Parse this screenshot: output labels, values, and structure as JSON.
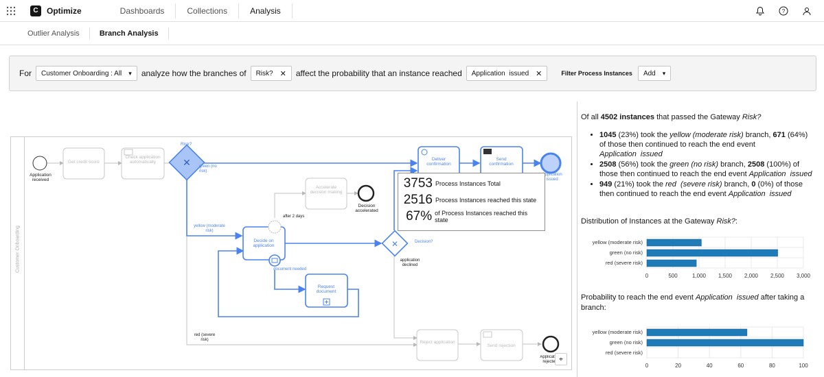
{
  "header": {
    "brand": "Optimize",
    "logo_letter": "C",
    "nav": [
      "Dashboards",
      "Collections",
      "Analysis"
    ]
  },
  "subnav": {
    "tabs": [
      "Outlier Analysis",
      "Branch Analysis"
    ]
  },
  "control": {
    "for_text": "For",
    "process_select": "Customer Onboarding : All",
    "analyze_text": "analyze how the branches of",
    "gateway_chip": "Risk?",
    "affect_text": "affect the probability that an instance reached",
    "end_event_chip": "Application  issued",
    "filter_label": "Filter Process Instances",
    "add_label": "Add"
  },
  "diagram": {
    "lane_name": "Customer Onboarding",
    "nodes": {
      "start": "Application received",
      "get_credit": "Get credit score",
      "check_app": "Check application automatically",
      "gateway_risk": "Risk?",
      "deliver": "Deliver confirmation",
      "send_conf": "Send confirmation",
      "end_issued": "Application issued",
      "accelerate": "Accelerate decision making",
      "decision_accel": "Decision accelerated",
      "after_days": "after 2 days",
      "decide": "Decide on application",
      "doc_needed": "document needed",
      "request_doc": "Request document",
      "decision_gw": "Decision?",
      "app_declined": "application declined",
      "reject": "Reject application",
      "send_rejection": "Send rejection",
      "end_rejected": "Application rejected"
    },
    "flows": {
      "green": "green (no risk)",
      "yellow": "yellow (moderate risk)",
      "red": "red (severe risk)"
    },
    "tooltip": {
      "rows": [
        {
          "value": "3753",
          "label": "Process Instances Total"
        },
        {
          "value": "2516",
          "label": "Process Instances reached this state"
        },
        {
          "value": "67%",
          "label": "of Process Instances reached this state"
        }
      ]
    }
  },
  "stats": {
    "intro": {
      "pre": "Of all ",
      "bold": "4502 instances",
      "mid": " that passed the Gateway ",
      "it": "Risk?"
    },
    "bullets": [
      {
        "n": "1045",
        "pct": " (23%) took the ",
        "branch": "yellow (moderate risk)",
        "mid": " branch, ",
        "n2": "671",
        "rest": " (64%) of those then continued to reach the end event ",
        "end": "Application  issued"
      },
      {
        "n": "2508",
        "pct": " (56%) took the ",
        "branch": "green (no risk)",
        "mid": " branch, ",
        "n2": "2508",
        "rest": " (100%) of those then continued to reach the end event ",
        "end": "Application  issued"
      },
      {
        "n": "949",
        "pct": " (21%) took the ",
        "branch": "red  (severe risk)",
        "mid": " branch, ",
        "n2": "0",
        "rest": " (0%) of those then continued to reach the end event ",
        "end": "Application  issued"
      }
    ],
    "dist_title": {
      "pre": "Distribution of Instances at the Gateway ",
      "it": "Risk?",
      "post": ":"
    },
    "prob_title": {
      "pre": "Probability to reach the end event ",
      "it": "Application  issued",
      "post": " after taking a branch:"
    }
  },
  "chart_data": [
    {
      "type": "bar",
      "orientation": "horizontal",
      "categories": [
        "yellow (moderate risk)",
        "green (no risk)",
        "red  (severe risk)"
      ],
      "values": [
        1045,
        2508,
        949
      ],
      "xlim": [
        0,
        3000
      ],
      "ticks": [
        "0",
        "500",
        "1,000",
        "1,500",
        "2,000",
        "2,500",
        "3,000"
      ],
      "tick_values": [
        0,
        500,
        1000,
        1500,
        2000,
        2500,
        3000
      ],
      "color": "#1f7ab8",
      "grid": true
    },
    {
      "type": "bar",
      "orientation": "horizontal",
      "categories": [
        "yellow (moderate risk)",
        "green (no risk)",
        "red  (severe risk)"
      ],
      "values": [
        64,
        100,
        0
      ],
      "xlim": [
        0,
        100
      ],
      "ticks": [
        "0",
        "20",
        "40",
        "60",
        "80",
        "100"
      ],
      "tick_values": [
        0,
        20,
        40,
        60,
        80,
        100
      ],
      "color": "#1f7ab8",
      "grid": true
    }
  ]
}
